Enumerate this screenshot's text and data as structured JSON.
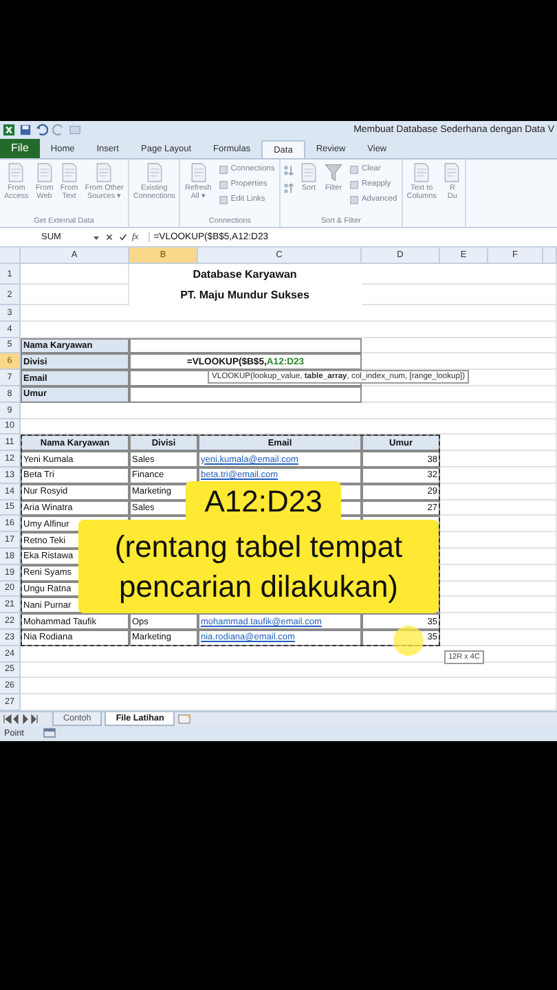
{
  "window": {
    "title": "Membuat Database Sederhana dengan Data V"
  },
  "tabs": [
    {
      "label": "File",
      "kind": "file",
      "selected": false
    },
    {
      "label": "Home",
      "kind": "tab",
      "selected": false
    },
    {
      "label": "Insert",
      "kind": "tab",
      "selected": false
    },
    {
      "label": "Page Layout",
      "kind": "tab",
      "selected": false
    },
    {
      "label": "Formulas",
      "kind": "tab",
      "selected": false
    },
    {
      "label": "Data",
      "kind": "tab",
      "selected": true
    },
    {
      "label": "Review",
      "kind": "tab",
      "selected": false
    },
    {
      "label": "View",
      "kind": "tab",
      "selected": false
    }
  ],
  "ribbon": [
    {
      "label": "Get External Data",
      "buttons": [
        {
          "kind": "large",
          "lines": [
            "From",
            "Access"
          ]
        },
        {
          "kind": "large",
          "lines": [
            "From",
            "Web"
          ]
        },
        {
          "kind": "large",
          "lines": [
            "From",
            "Text"
          ]
        },
        {
          "kind": "large",
          "lines": [
            "From Other",
            "Sources ▾"
          ]
        }
      ]
    },
    {
      "buttons": [
        {
          "kind": "large",
          "lines": [
            "Existing",
            "Connections"
          ]
        }
      ]
    },
    {
      "label": "Connections",
      "buttons": [
        {
          "kind": "large",
          "lines": [
            "Refresh",
            "All ▾"
          ]
        },
        {
          "kind": "small",
          "lines": [
            "Connections",
            "Properties",
            "Edit Links"
          ]
        }
      ]
    },
    {
      "label": "Sort & Filter",
      "buttons": [
        {
          "kind": "sort"
        },
        {
          "kind": "large",
          "lines": [
            "Sort"
          ]
        },
        {
          "kind": "filter",
          "lines": [
            "Filter"
          ]
        },
        {
          "kind": "small",
          "lines": [
            "Clear",
            "Reapply",
            "Advanced"
          ]
        }
      ]
    },
    {
      "buttons": [
        {
          "kind": "large",
          "lines": [
            "Text to",
            "Columns"
          ]
        },
        {
          "kind": "large",
          "lines": [
            "R",
            "Du"
          ]
        }
      ]
    }
  ],
  "formula_bar": {
    "name_box": "SUM",
    "fx": "fx",
    "formula": "=VLOOKUP($B$5,A12:D23"
  },
  "columns": [
    {
      "label": "A",
      "selected": false
    },
    {
      "label": "B",
      "selected": true
    },
    {
      "label": "C",
      "selected": false
    },
    {
      "label": "D",
      "selected": false
    },
    {
      "label": "E",
      "selected": false
    },
    {
      "label": "F",
      "selected": false
    }
  ],
  "rows": [
    {
      "number": "1",
      "kind": "title",
      "selected": false,
      "text": "Database Karyawan"
    },
    {
      "number": "2",
      "kind": "title",
      "selected": false,
      "text": "PT. Maju Mundur Sukses"
    },
    {
      "number": "3",
      "kind": "blank",
      "selected": false
    },
    {
      "number": "4",
      "kind": "blank",
      "selected": false
    },
    {
      "number": "5",
      "kind": "form",
      "selected": false,
      "label": "Nama Karyawan"
    },
    {
      "number": "6",
      "kind": "form",
      "selected": true,
      "label": "Divisi",
      "formula": "=VLOOKUP($B$5,",
      "reference": "A12:D23"
    },
    {
      "number": "7",
      "kind": "form",
      "selected": false,
      "label": "Email"
    },
    {
      "number": "8",
      "kind": "form",
      "selected": false,
      "label": "Umur"
    },
    {
      "number": "9",
      "kind": "blank",
      "selected": false
    },
    {
      "number": "10",
      "kind": "blank",
      "selected": false
    },
    {
      "number": "11",
      "kind": "header",
      "selected": false,
      "cells": [
        "Nama Karyawan",
        "Divisi",
        "Email",
        "Umur"
      ]
    },
    {
      "number": "12",
      "kind": "record",
      "selected": false,
      "name": "Yeni Kumala",
      "division": "Sales",
      "email": "yeni.kumala@email.com",
      "age": "38"
    },
    {
      "number": "13",
      "kind": "record",
      "selected": false,
      "name": "Beta Tri",
      "division": "Finance",
      "email": "beta.tri@email.com",
      "age": "32"
    },
    {
      "number": "14",
      "kind": "record",
      "selected": false,
      "name": "Nur Rosyid",
      "division": "Marketing",
      "age": "29"
    },
    {
      "number": "15",
      "kind": "record",
      "selected": false,
      "name": "Aria Winatra",
      "division": "Sales",
      "age": "27"
    },
    {
      "number": "16",
      "kind": "record",
      "selected": false,
      "name": "Umy Alfinur"
    },
    {
      "number": "17",
      "kind": "record",
      "selected": false,
      "name": "Retno Teki"
    },
    {
      "number": "18",
      "kind": "record",
      "selected": false,
      "name": "Eka Ristawa"
    },
    {
      "number": "19",
      "kind": "record",
      "selected": false,
      "name": "Reni Syams"
    },
    {
      "number": "20",
      "kind": "record",
      "selected": false,
      "name": "Ungu Ratna"
    },
    {
      "number": "21",
      "kind": "record",
      "selected": false,
      "name": "Nani Purnar"
    },
    {
      "number": "22",
      "kind": "record",
      "selected": false,
      "name": "Mohammad Taufik",
      "division": "Ops",
      "email": "mohammad.taufik@email.com",
      "age": "35"
    },
    {
      "number": "23",
      "kind": "record",
      "selected": false,
      "name": "Nia Rodiana",
      "division": "Marketing",
      "email": "nia.rodiana@email.com",
      "age": "35"
    },
    {
      "number": "24",
      "kind": "blank",
      "selected": false
    },
    {
      "number": "25",
      "kind": "blank",
      "selected": false
    },
    {
      "number": "26",
      "kind": "blank",
      "selected": false
    },
    {
      "number": "27",
      "kind": "blank",
      "selected": false
    }
  ],
  "function_tooltip": "VLOOKUP(lookup_value, **table_array**, col_index_num, [range_lookup])",
  "selection_size": "12R x 4C",
  "caption": {
    "title": "A12:D23",
    "lines": [
      "(rentang tabel tempat",
      "pencarian dilakukan)"
    ]
  },
  "sheet_tabs": [
    {
      "label": "Contoh",
      "selected": false
    },
    {
      "label": "File Latihan",
      "selected": true
    }
  ],
  "status_bar": {
    "mode": "Point"
  }
}
